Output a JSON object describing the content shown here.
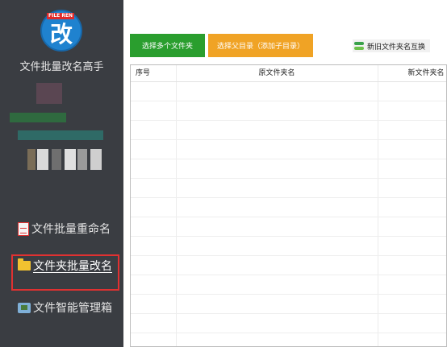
{
  "sidebar": {
    "logo_tag": "FILE REN",
    "logo_char": "改",
    "app_title": "文件批量改名高手",
    "nav": [
      {
        "label": "文件批量重命名",
        "icon": "document-icon"
      },
      {
        "label": "文件夹批量改名",
        "icon": "folder-icon"
      },
      {
        "label": "文件智能管理箱",
        "icon": "toolbox-icon"
      }
    ]
  },
  "toolbar": {
    "select_folders": "选择多个文件夹",
    "select_parent": "选择父目录（添加子目录）",
    "swap_names": "新旧文件夹名互换"
  },
  "table": {
    "columns": [
      "序号",
      "原文件夹名",
      "新文件夹名"
    ],
    "rows": []
  },
  "colors": {
    "sidebar_bg": "#3a3d42",
    "green_button": "#2a9e2e",
    "orange_button": "#f0a325",
    "highlight": "#e03131"
  }
}
